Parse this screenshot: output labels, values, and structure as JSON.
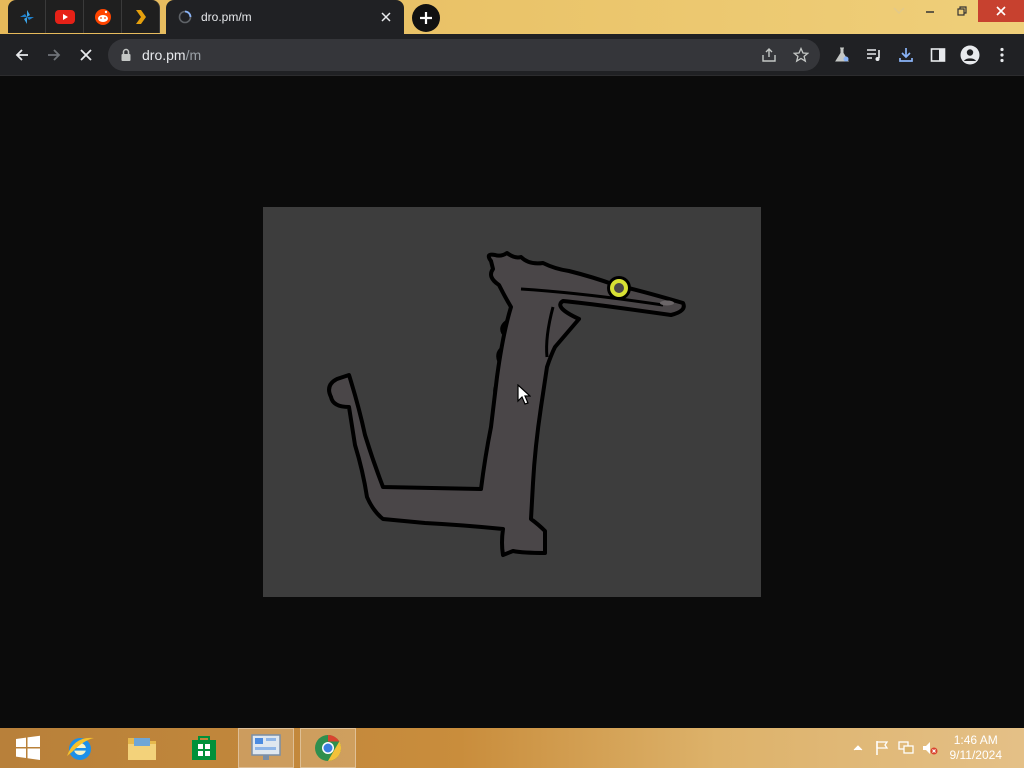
{
  "browser": {
    "pinned_tabs": [
      {
        "name": "pinned-tab-1",
        "icon": "blue-pinwheel-icon"
      },
      {
        "name": "pinned-tab-youtube",
        "icon": "youtube-icon"
      },
      {
        "name": "pinned-tab-reddit",
        "icon": "reddit-icon"
      },
      {
        "name": "pinned-tab-plex",
        "icon": "plex-chevron-icon"
      }
    ],
    "active_tab": {
      "title": "dro.pm/m",
      "icon": "loading-globe-icon"
    },
    "address_bar": {
      "host": "dro.pm",
      "path": "/m"
    }
  },
  "taskbar": {
    "apps": [
      {
        "name": "start-button",
        "icon": "windows-logo-icon"
      },
      {
        "name": "internet-explorer",
        "icon": "ie-icon"
      },
      {
        "name": "file-explorer",
        "icon": "folder-icon"
      },
      {
        "name": "windows-store",
        "icon": "store-icon"
      },
      {
        "name": "control-panel",
        "icon": "control-panel-icon"
      },
      {
        "name": "chrome",
        "icon": "chrome-icon"
      }
    ],
    "clock": {
      "time": "1:46 AM",
      "date": "9/11/2024"
    }
  },
  "colors": {
    "tabstrip": "#e6b95a",
    "toolbar": "#202124",
    "omnibox": "#35363a",
    "page_background": "#0b0b0b",
    "canvas": "#3d3d3d",
    "creature_body": "#4a4648",
    "creature_eye": "#d7e034",
    "close_button": "#c7412f"
  }
}
